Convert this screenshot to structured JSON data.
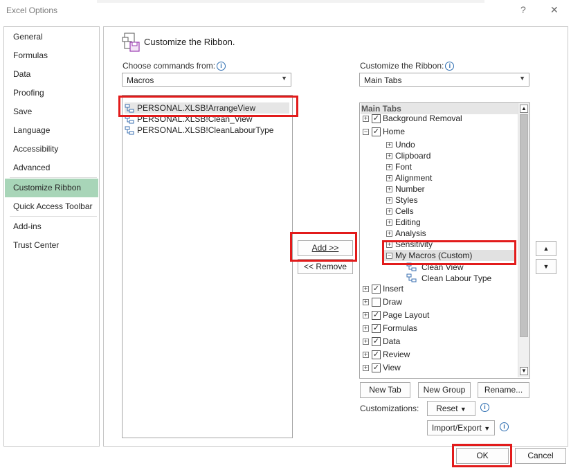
{
  "window": {
    "title": "Excel Options",
    "help_glyph": "?",
    "close_glyph": "✕"
  },
  "nav": {
    "items": [
      {
        "label": "General"
      },
      {
        "label": "Formulas"
      },
      {
        "label": "Data"
      },
      {
        "label": "Proofing"
      },
      {
        "label": "Save"
      },
      {
        "label": "Language"
      },
      {
        "label": "Accessibility"
      },
      {
        "label": "Advanced"
      },
      {
        "label": "Customize Ribbon"
      },
      {
        "label": "Quick Access Toolbar"
      },
      {
        "label": "Add-ins"
      },
      {
        "label": "Trust Center"
      }
    ],
    "selected": "Customize Ribbon"
  },
  "heading": "Customize the Ribbon.",
  "left": {
    "label": "Choose commands from:",
    "combo_value": "Macros",
    "commands": [
      {
        "label": "PERSONAL.XLSB!ArrangeView"
      },
      {
        "label": "PERSONAL.XLSB!Clean_View"
      },
      {
        "label": "PERSONAL.XLSB!CleanLabourType"
      }
    ]
  },
  "buttons": {
    "add": "Add >>",
    "remove": "<< Remove",
    "ok": "OK",
    "cancel": "Cancel",
    "new_tab": "New Tab",
    "new_group": "New Group",
    "rename": "Rename...",
    "reset": "Reset",
    "import_export": "Import/Export"
  },
  "right": {
    "label": "Customize the Ribbon:",
    "combo_value": "Main Tabs",
    "tree_header": "Main Tabs",
    "tree": {
      "background_removal": "Background Removal",
      "home": "Home",
      "groups": [
        "Undo",
        "Clipboard",
        "Font",
        "Alignment",
        "Number",
        "Styles",
        "Cells",
        "Editing",
        "Analysis",
        "Sensitivity"
      ],
      "custom_group": "My Macros (Custom)",
      "custom_items": [
        "Clean View",
        "Clean Labour Type"
      ],
      "tabs": [
        {
          "label": "Insert",
          "checked": true
        },
        {
          "label": "Draw",
          "checked": false
        },
        {
          "label": "Page Layout",
          "checked": true
        },
        {
          "label": "Formulas",
          "checked": true
        },
        {
          "label": "Data",
          "checked": true
        },
        {
          "label": "Review",
          "checked": true
        },
        {
          "label": "View",
          "checked": true
        }
      ]
    },
    "customizations_label": "Customizations:"
  },
  "colors": {
    "highlight_red": "#e21b1b",
    "nav_selected": "#a8d5b8"
  }
}
